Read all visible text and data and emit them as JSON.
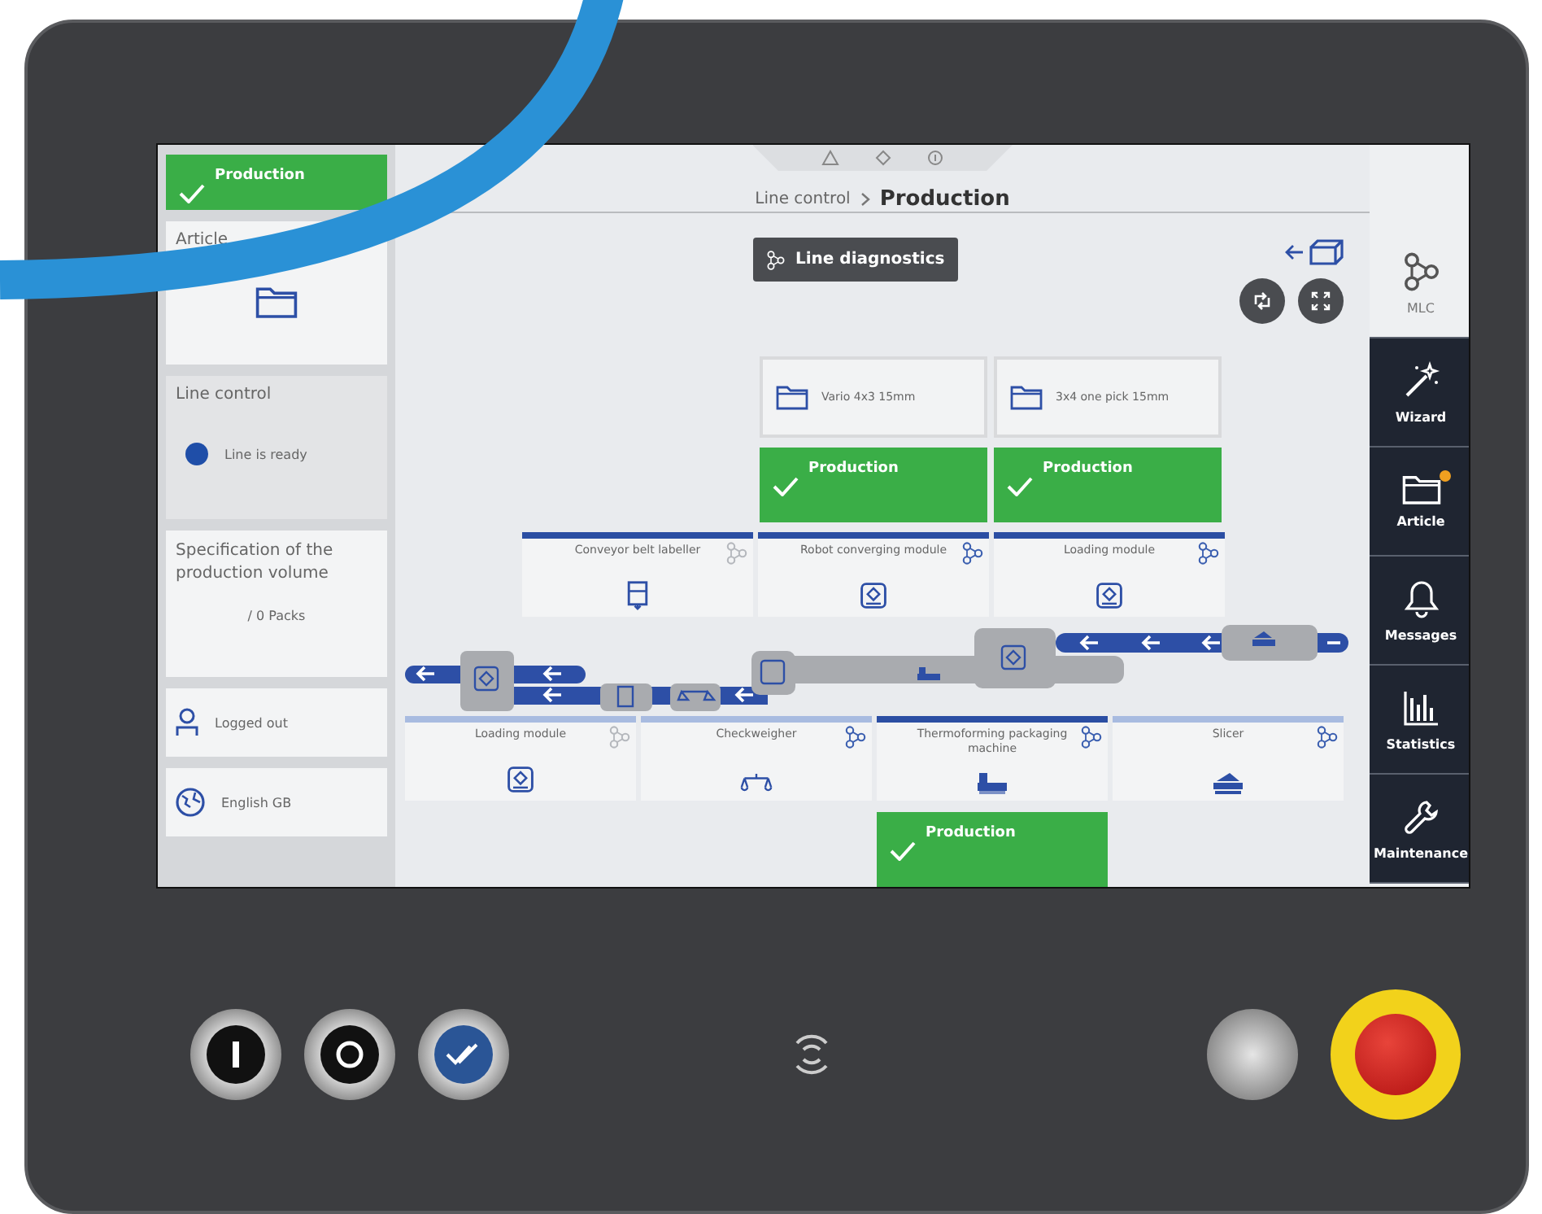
{
  "sidebar": {
    "status": {
      "label": "Production"
    },
    "article": {
      "title": "Article"
    },
    "line_control": {
      "title": "Line control",
      "status": "Line is ready"
    },
    "volume": {
      "title": "Specification of the production volume",
      "value": "/ 0 Packs"
    },
    "user": {
      "label": "Logged out"
    },
    "language": {
      "label": "English GB"
    }
  },
  "header": {
    "breadcrumb": [
      {
        "label": "Line control",
        "current": false
      },
      {
        "label": "Production",
        "current": true
      }
    ]
  },
  "diagnostics_button": {
    "label": "Line diagnostics"
  },
  "article_stations": [
    {
      "article": "Vario 4x3 15mm",
      "status": "Production"
    },
    {
      "article": "3x4 one pick 15mm",
      "status": "Production"
    }
  ],
  "upper_modules": [
    {
      "name": "Conveyor belt labeller",
      "kind": "labeller",
      "diagnostics": false,
      "selected": true
    },
    {
      "name": "Robot converging module",
      "kind": "robot",
      "diagnostics": true,
      "selected": true
    },
    {
      "name": "Loading module",
      "kind": "robot",
      "diagnostics": true,
      "selected": true
    }
  ],
  "lower_modules": [
    {
      "name": "Loading module",
      "kind": "robot",
      "diagnostics": false,
      "selected": false
    },
    {
      "name": "Checkweigher",
      "kind": "scale",
      "diagnostics": true,
      "selected": false
    },
    {
      "name": "Thermoforming packaging machine",
      "kind": "thermoformer",
      "diagnostics": true,
      "selected": true,
      "status": "Production"
    },
    {
      "name": "Slicer",
      "kind": "slicer",
      "diagnostics": true,
      "selected": false
    }
  ],
  "nav": [
    {
      "label": "MLC",
      "kind": "mlc",
      "selected": true,
      "notification": false
    },
    {
      "label": "Wizard",
      "kind": "wand",
      "selected": false,
      "notification": false
    },
    {
      "label": "Article",
      "kind": "folder",
      "selected": false,
      "notification": true
    },
    {
      "label": "Messages",
      "kind": "bell",
      "selected": false,
      "notification": false
    },
    {
      "label": "Statistics",
      "kind": "chart",
      "selected": false,
      "notification": false
    },
    {
      "label": "Maintenance",
      "kind": "wrench",
      "selected": false,
      "notification": false
    }
  ]
}
